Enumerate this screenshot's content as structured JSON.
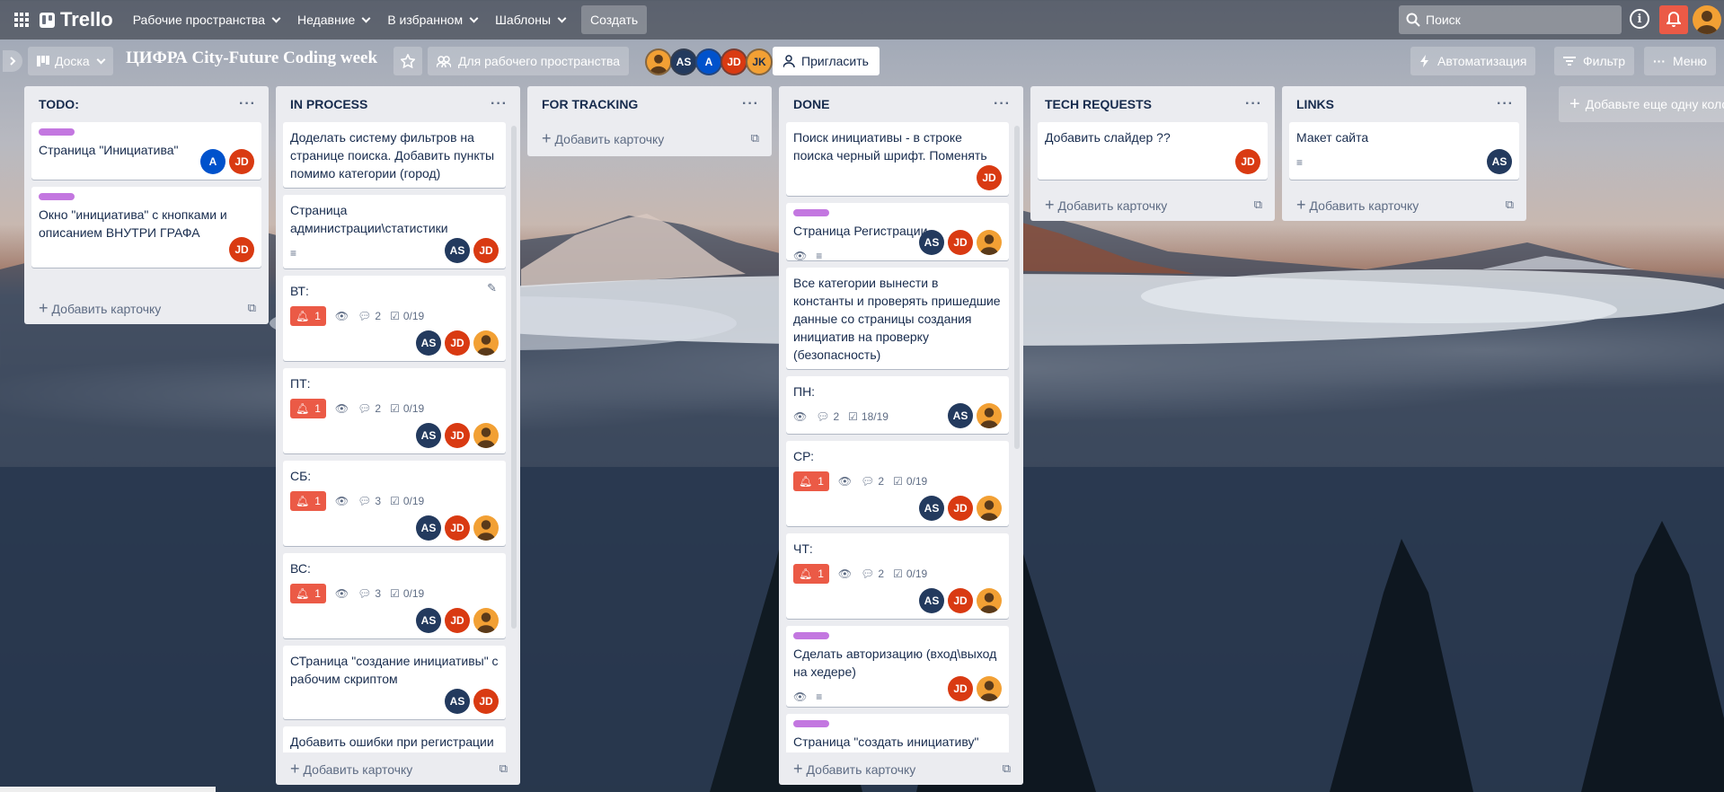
{
  "nav": {
    "logo": "Trello",
    "workspaces": "Рабочие пространства",
    "recent": "Недавние",
    "starred": "В избранном",
    "templates": "Шаблоны",
    "create": "Создать",
    "search_placeholder": "Поиск"
  },
  "board": {
    "view": "Доска",
    "title": "ЦИФРА City-Future Coding week",
    "visibility": "Для рабочего пространства",
    "members": [
      "AS",
      "A",
      "JD",
      "JK"
    ],
    "invite": "Пригласить",
    "automation": "Автоматизация",
    "filter": "Фильтр",
    "menu": "Меню"
  },
  "add_card": "Добавить карточку",
  "add_list": "Добавьте еще одну колонку",
  "lists": [
    {
      "title": "TODO:",
      "cards": [
        {
          "title": "Страница \"Инициатива\"",
          "members": [
            "A",
            "JD"
          ]
        },
        {
          "title": "Окно \"инициатива\" с кнопками и описанием ВНУТРИ ГРАФА",
          "members": [
            "JD"
          ]
        }
      ]
    },
    {
      "title": "IN PROCESS",
      "cards": [
        {
          "title": "Доделать систему фильтров на странице поиска. Добавить пункты помимо категории (город)"
        },
        {
          "title": "Страница администрации\\статистики",
          "members": [
            "AS",
            "JD"
          ]
        },
        {
          "title": "ВТ:",
          "due": "1",
          "comments": "2",
          "checklist": "0/19",
          "members": [
            "AS",
            "JD",
            "user"
          ]
        },
        {
          "title": "ПТ:",
          "due": "1",
          "comments": "2",
          "checklist": "0/19",
          "members": [
            "AS",
            "JD",
            "user"
          ]
        },
        {
          "title": "СБ:",
          "due": "1",
          "comments": "3",
          "checklist": "0/19",
          "members": [
            "AS",
            "JD",
            "user"
          ]
        },
        {
          "title": "ВС:",
          "due": "1",
          "comments": "3",
          "checklist": "0/19",
          "members": [
            "AS",
            "JD",
            "user"
          ]
        },
        {
          "title": "СТраница \"создание инициативы\" с рабочим скриптом",
          "members": [
            "AS",
            "JD"
          ]
        },
        {
          "title": "Добавить ошибки при регистрации и входе, добавить функционал к"
        }
      ]
    },
    {
      "title": "FOR TRACKING",
      "cards": []
    },
    {
      "title": "DONE",
      "cards": [
        {
          "title": "Поиск инициативы - в строке поиска черный шрифт. Поменять",
          "members": [
            "JD"
          ]
        },
        {
          "title": "Страница Регистрации",
          "members": [
            "AS",
            "JD",
            "user"
          ]
        },
        {
          "title": "Все категории вынести в константы и проверять пришедшие данные со страницы создания инициатив на проверку (безопасность)"
        },
        {
          "title": "ПН:",
          "comments": "2",
          "checklist": "18/19",
          "members": [
            "AS",
            "user"
          ]
        },
        {
          "title": "СР:",
          "due": "1",
          "comments": "2",
          "checklist": "0/19",
          "members": [
            "AS",
            "JD",
            "user"
          ]
        },
        {
          "title": "ЧТ:",
          "due": "1",
          "comments": "2",
          "checklist": "0/19",
          "members": [
            "AS",
            "JD",
            "user"
          ]
        },
        {
          "title": "Сделать авторизацию (вход\\выход на хедере)",
          "members": [
            "JD",
            "user"
          ]
        },
        {
          "title": "Страница \"создать инициативу\""
        }
      ]
    },
    {
      "title": "TECH REQUESTS",
      "cards": [
        {
          "title": "Добавить слайдер ??",
          "members": [
            "JD"
          ]
        }
      ]
    },
    {
      "title": "LINKS",
      "cards": [
        {
          "title": "Макет сайта",
          "members": [
            "AS"
          ]
        }
      ]
    }
  ]
}
